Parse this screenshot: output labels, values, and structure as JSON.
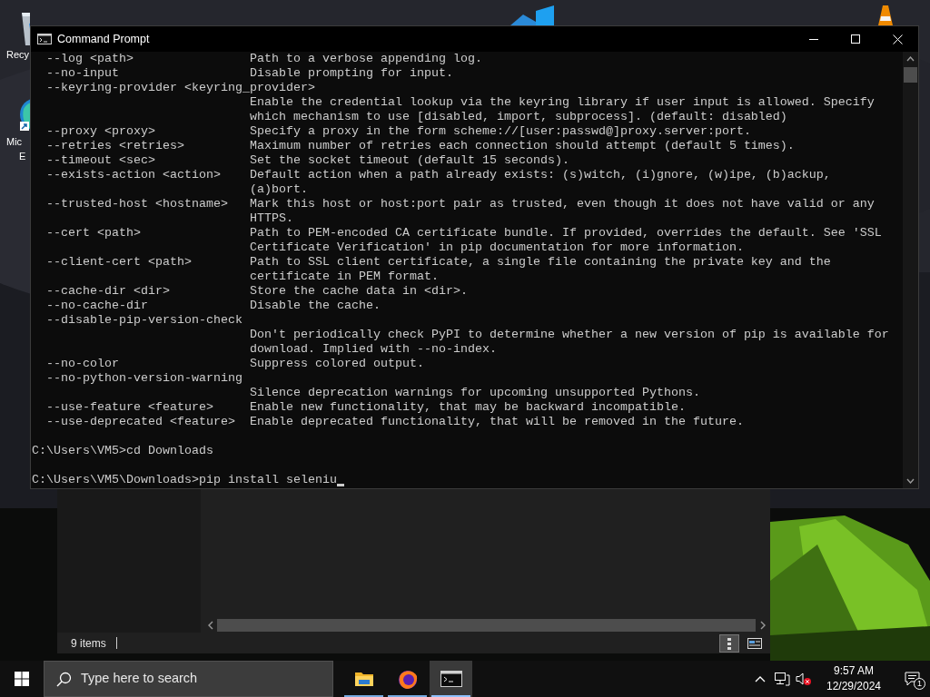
{
  "desktop_icons": [
    {
      "kind": "bin",
      "label_lines": [
        "Recy"
      ]
    },
    {
      "kind": "browser",
      "label_lines": [
        "Mic",
        "E"
      ]
    }
  ],
  "command_prompt": {
    "title": "Command Prompt",
    "lines": [
      {
        "kind": "option",
        "option": "--log <path>",
        "description": "Path to a verbose appending log."
      },
      {
        "kind": "option",
        "option": "--no-input",
        "description": "Disable prompting for input."
      },
      {
        "kind": "option",
        "option": "--keyring-provider <keyring_provider>"
      },
      {
        "kind": "option",
        "description": "Enable the credential lookup via the keyring library if user input is allowed. Specify"
      },
      {
        "kind": "option",
        "description": "which mechanism to use [disabled, import, subprocess]. (default: disabled)"
      },
      {
        "kind": "option",
        "option": "--proxy <proxy>",
        "description": "Specify a proxy in the form scheme://[user:passwd@]proxy.server:port."
      },
      {
        "kind": "option",
        "option": "--retries <retries>",
        "description": "Maximum number of retries each connection should attempt (default 5 times)."
      },
      {
        "kind": "option",
        "option": "--timeout <sec>",
        "description": "Set the socket timeout (default 15 seconds)."
      },
      {
        "kind": "option",
        "option": "--exists-action <action>",
        "description": "Default action when a path already exists: (s)witch, (i)gnore, (w)ipe, (b)ackup,"
      },
      {
        "kind": "option",
        "description": "(a)bort."
      },
      {
        "kind": "option",
        "option": "--trusted-host <hostname>",
        "description": "Mark this host or host:port pair as trusted, even though it does not have valid or any"
      },
      {
        "kind": "option",
        "description": "HTTPS."
      },
      {
        "kind": "option",
        "option": "--cert <path>",
        "description": "Path to PEM-encoded CA certificate bundle. If provided, overrides the default. See 'SSL"
      },
      {
        "kind": "option",
        "description": "Certificate Verification' in pip documentation for more information."
      },
      {
        "kind": "option",
        "option": "--client-cert <path>",
        "description": "Path to SSL client certificate, a single file containing the private key and the"
      },
      {
        "kind": "option",
        "description": "certificate in PEM format."
      },
      {
        "kind": "option",
        "option": "--cache-dir <dir>",
        "description": "Store the cache data in <dir>."
      },
      {
        "kind": "option",
        "option": "--no-cache-dir",
        "description": "Disable the cache."
      },
      {
        "kind": "option",
        "option": "--disable-pip-version-check"
      },
      {
        "kind": "option",
        "description": "Don't periodically check PyPI to determine whether a new version of pip is available for"
      },
      {
        "kind": "option",
        "description": "download. Implied with --no-index."
      },
      {
        "kind": "option",
        "option": "--no-color",
        "description": "Suppress colored output."
      },
      {
        "kind": "option",
        "option": "--no-python-version-warning"
      },
      {
        "kind": "option",
        "description": "Silence deprecation warnings for upcoming unsupported Pythons."
      },
      {
        "kind": "option",
        "option": "--use-feature <feature>",
        "description": "Enable new functionality, that may be backward incompatible."
      },
      {
        "kind": "option",
        "option": "--use-deprecated <feature>",
        "description": "Enable deprecated functionality, that will be removed in the future."
      },
      {
        "kind": "blank"
      },
      {
        "kind": "prompt",
        "text": "C:\\Users\\VM5>cd Downloads",
        "cursor": false
      },
      {
        "kind": "blank"
      },
      {
        "kind": "prompt",
        "text": "C:\\Users\\VM5\\Downloads>pip install seleniu",
        "cursor": true
      }
    ]
  },
  "explorer": {
    "status": "9 items",
    "view_buttons": [
      {
        "kind": "details",
        "selected": true
      },
      {
        "kind": "tiles",
        "selected": false
      }
    ]
  },
  "taskbar": {
    "search_placeholder": "Type here to search",
    "apps": [
      {
        "kind": "folder",
        "selected": false
      },
      {
        "kind": "browser",
        "selected": false
      },
      {
        "kind": "terminal",
        "selected": true
      }
    ],
    "time": "9:57 AM",
    "date": "12/29/2024",
    "notification_count": "1"
  }
}
